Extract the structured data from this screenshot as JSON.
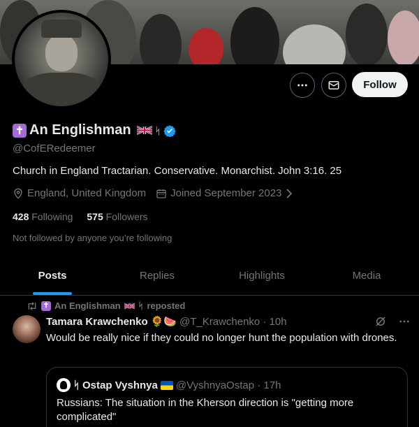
{
  "profile": {
    "cross_glyph": "✝",
    "name": "An Englishman",
    "rune": "ᛋ",
    "handle": "@CofERedeemer",
    "bio": "Church in England Tractarian. Conservative. Monarchist. John 3:16. 25",
    "location": "England, United Kingdom",
    "joined": "Joined September 2023",
    "following_count": "428",
    "following_label": "Following",
    "followers_count": "575",
    "followers_label": "Followers",
    "followed_note": "Not followed by anyone you’re following",
    "verified_color": "#1d9bf0"
  },
  "actions": {
    "more_icon": "more-icon",
    "message_icon": "message-icon",
    "follow_label": "Follow"
  },
  "tabs": [
    {
      "label": "Posts",
      "active": true
    },
    {
      "label": "Replies",
      "active": false
    },
    {
      "label": "Highlights",
      "active": false
    },
    {
      "label": "Media",
      "active": false
    }
  ],
  "feed": {
    "repost_by": "An Englishman",
    "repost_suffix": "reposted",
    "post": {
      "author": "Tamara Krawchenko",
      "author_emoji": "🌻🍉",
      "handle_time": "@T_Krawchenko · 10h",
      "text": "Would be really nice if they could no longer hunt the population with drones."
    },
    "quote": {
      "author": "Ostap Vyshnya",
      "author_prefix": "ᛋ",
      "handle_time": "@VyshnyaOstap · 17h",
      "text": "Russians: The situation in the Kherson direction is \"getting more complicated\""
    }
  }
}
